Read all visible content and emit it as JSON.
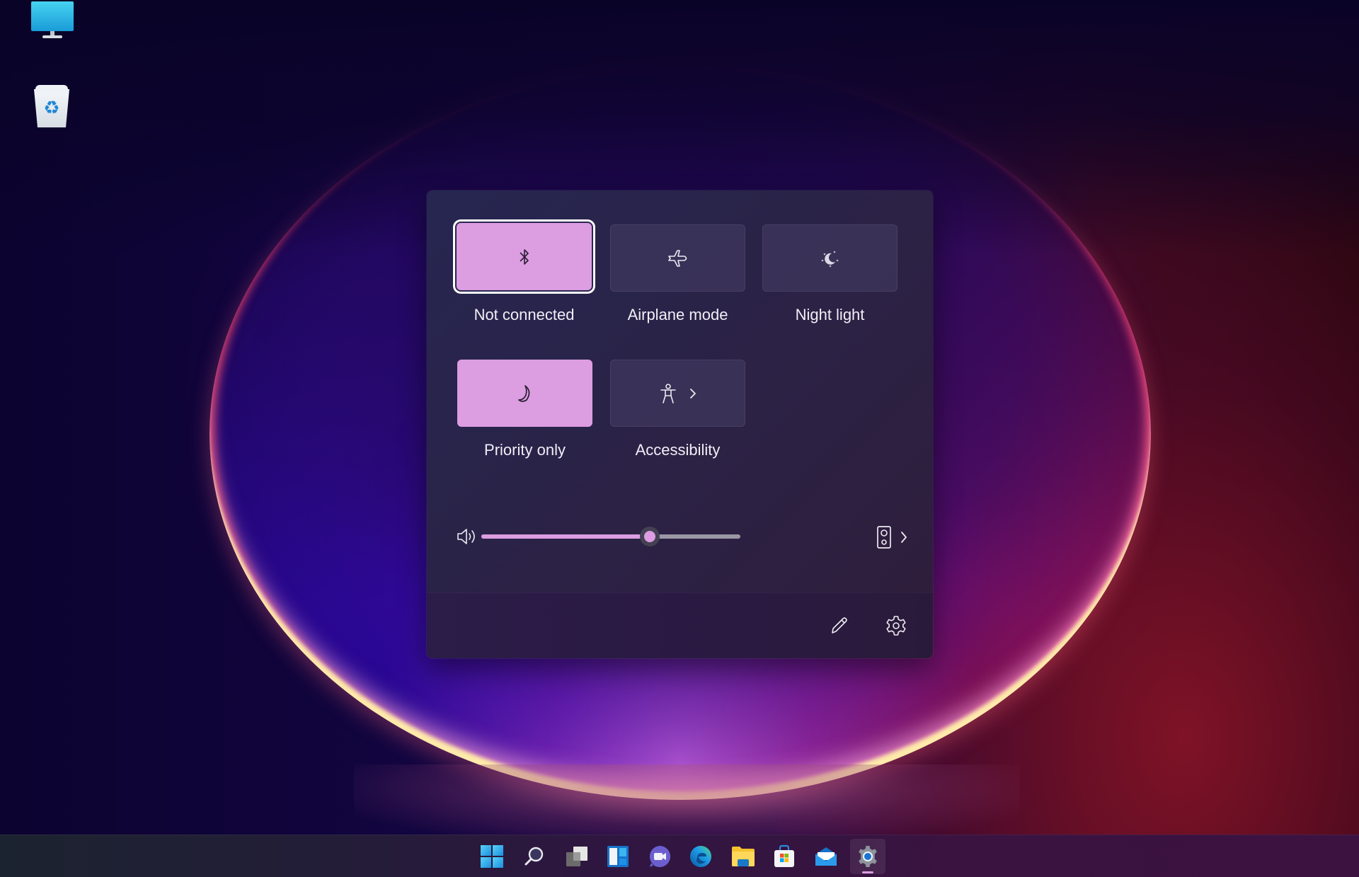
{
  "desktop": {
    "icons": [
      {
        "name": "This PC",
        "icon": "monitor-icon"
      },
      {
        "name": "Recycle Bin",
        "icon": "recycle-bin-icon"
      }
    ]
  },
  "quick_settings": {
    "tiles": [
      {
        "id": "bluetooth",
        "label": "Not connected",
        "icon": "bluetooth-icon",
        "state": "on",
        "focused": true
      },
      {
        "id": "airplane",
        "label": "Airplane mode",
        "icon": "airplane-icon",
        "state": "off"
      },
      {
        "id": "night-light",
        "label": "Night light",
        "icon": "night-light-icon",
        "state": "off"
      },
      {
        "id": "focus-assist",
        "label": "Priority only",
        "icon": "moon-icon",
        "state": "on"
      },
      {
        "id": "accessibility",
        "label": "Accessibility",
        "icon": "accessibility-icon",
        "state": "off",
        "has_submenu": true
      }
    ],
    "volume": {
      "icon": "speaker-volume-icon",
      "level_percent": 65,
      "output_device_icon": "speaker-device-icon",
      "output_chevron": "chevron-right-icon"
    },
    "footer": {
      "edit_icon": "pencil-icon",
      "settings_icon": "gear-icon"
    }
  },
  "taskbar": {
    "items": [
      {
        "name": "Start",
        "icon": "windows-start-icon",
        "active": false
      },
      {
        "name": "Search",
        "icon": "search-icon",
        "active": false
      },
      {
        "name": "Task View",
        "icon": "task-view-icon",
        "active": false
      },
      {
        "name": "Widgets",
        "icon": "widgets-icon",
        "active": false
      },
      {
        "name": "Chat",
        "icon": "teams-chat-icon",
        "active": false
      },
      {
        "name": "Microsoft Edge",
        "icon": "edge-icon",
        "active": false
      },
      {
        "name": "File Explorer",
        "icon": "folder-icon",
        "active": false
      },
      {
        "name": "Microsoft Store",
        "icon": "store-icon",
        "active": false
      },
      {
        "name": "Mail",
        "icon": "mail-icon",
        "active": false
      },
      {
        "name": "Settings",
        "icon": "settings-gear-icon",
        "active": true
      }
    ]
  },
  "colors": {
    "accent": "#dc9de1",
    "tile_off": "#3a3352",
    "panel": "#2a2348",
    "text": "#f2eef6"
  }
}
